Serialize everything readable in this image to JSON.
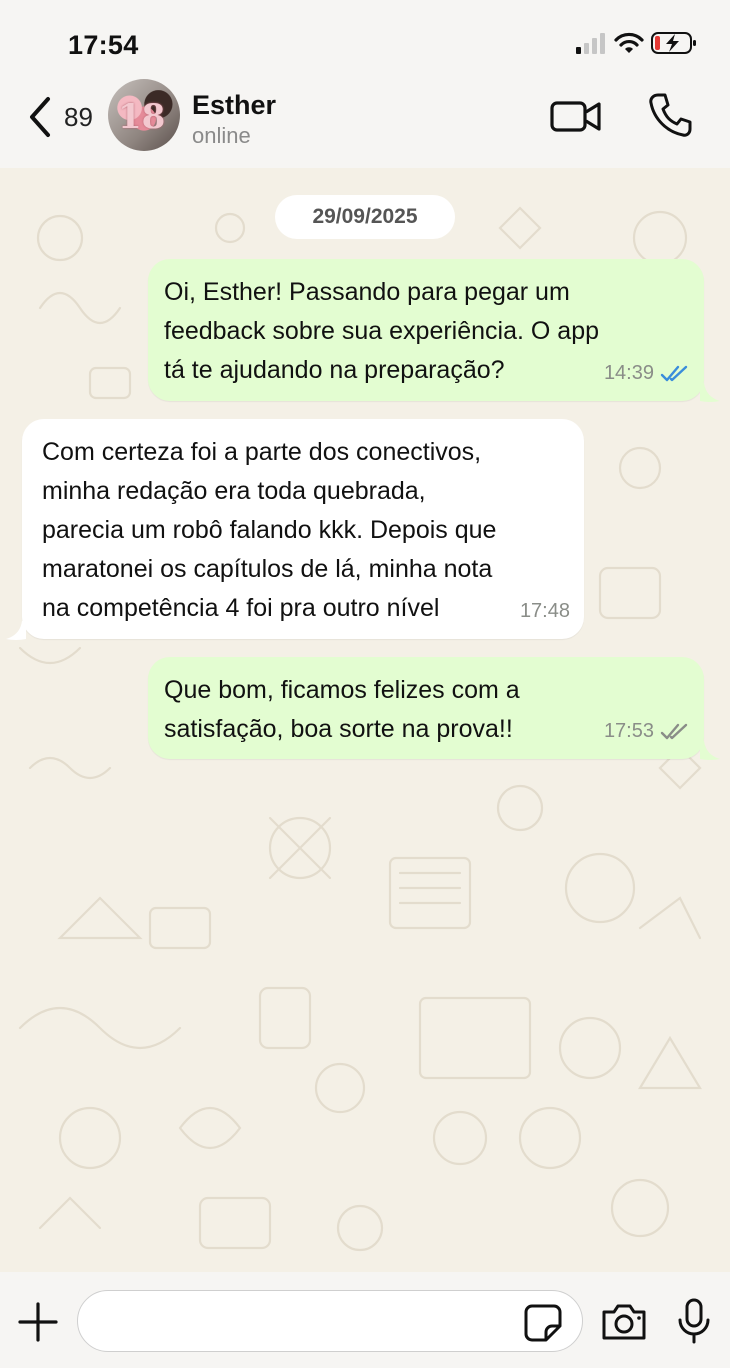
{
  "status_bar": {
    "time": "17:54"
  },
  "header": {
    "back_count": "89",
    "contact_name": "Esther",
    "contact_status": "online",
    "icons": [
      "chevron-left-icon",
      "avatar",
      "video-camera-icon",
      "phone-icon"
    ]
  },
  "chat": {
    "date_chip": "29/09/2025",
    "messages": [
      {
        "direction": "outgoing",
        "text": "Oi, Esther! Passando para pegar um\nfeedback sobre sua experiência. O app\ntá te ajudando na preparação?",
        "time": "14:39",
        "receipt": "read"
      },
      {
        "direction": "incoming",
        "text": "Com certeza foi a parte dos conectivos,\nminha redação era toda quebrada,\nparecia um robô falando kkk. Depois que\nmaratonei os capítulos de lá, minha nota\nna competência 4 foi pra outro nível",
        "time": "17:48"
      },
      {
        "direction": "outgoing",
        "text": "Que bom, ficamos felizes com a\nsatisfação, boa sorte na prova!!",
        "time": "17:53",
        "receipt": "delivered"
      }
    ]
  },
  "composer": {
    "input_value": "",
    "icons": [
      "plus-icon",
      "sticker-icon",
      "camera-icon",
      "microphone-icon"
    ]
  },
  "colors": {
    "outgoing_bubble": "#e3fdd1",
    "incoming_bubble": "#ffffff",
    "chat_background": "#f4f0e6",
    "read_receipt": "#3a8ddb",
    "delivered_receipt": "#8a8d88"
  }
}
